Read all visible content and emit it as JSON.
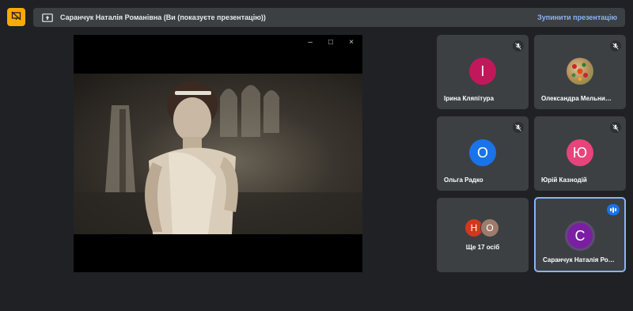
{
  "presenting_bar": {
    "title": "Саранчук Наталія Романівна (Ви (показуєте презентацію))",
    "stop_label": "Зупинити презентацію",
    "left_icon": "presentation-off-icon",
    "bar_icon": "present-to-all-icon"
  },
  "presentation": {
    "window_controls": [
      "minimize-icon",
      "maximize-icon",
      "close-icon"
    ],
    "minimize_glyph": "–",
    "maximize_glyph": "□",
    "close_glyph": "×"
  },
  "participants": [
    {
      "name": "Ірина Кляпітура",
      "initial": "І",
      "color": "#c2185b",
      "muted": true
    },
    {
      "name": "Олександра Мельни…",
      "initial": "",
      "color": "#c9a27a",
      "muted": true,
      "photo": true
    },
    {
      "name": "Ольга Радко",
      "initial": "О",
      "color": "#1a73e8",
      "muted": true
    },
    {
      "name": "Юрій Казнодій",
      "initial": "Ю",
      "color": "#e8437a",
      "muted": true
    }
  ],
  "more": {
    "label": "Ще 17 осіб",
    "avatars": [
      {
        "initial": "Н",
        "color": "#d0391b"
      },
      {
        "initial": "О",
        "color": "#9e7b6b"
      }
    ]
  },
  "self_tile": {
    "name": "Саранчук Наталія Ро…",
    "initial": "С",
    "color": "#7b1fa2",
    "speaking": true
  },
  "colors": {
    "background": "#202124",
    "tile": "#3c4043",
    "accent": "#8ab4f8",
    "present_icon_bg": "#f9ab00"
  }
}
